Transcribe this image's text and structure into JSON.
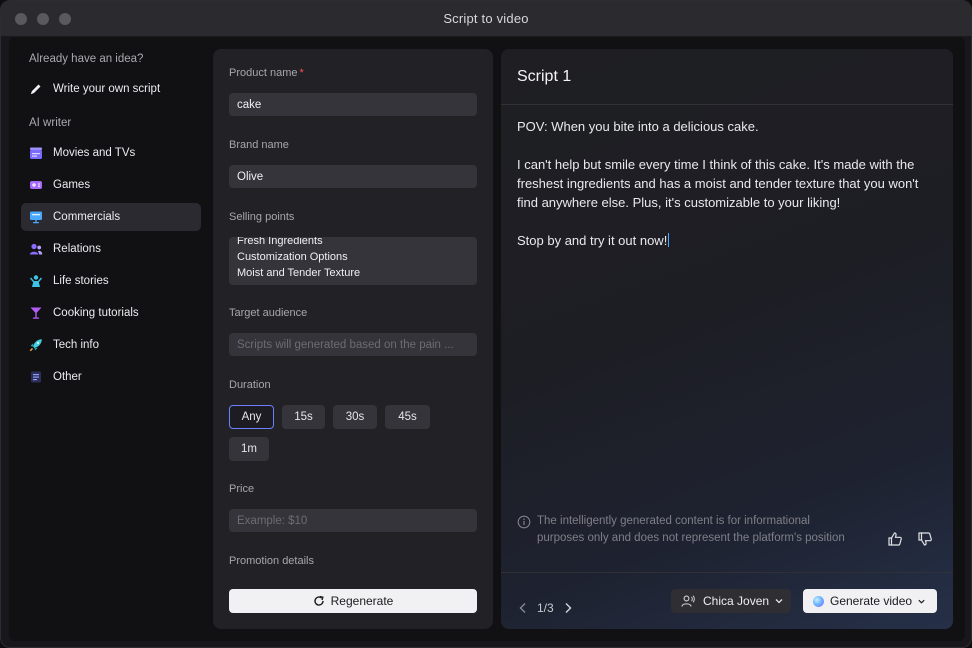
{
  "window": {
    "title": "Script to video"
  },
  "sidebar": {
    "heading_idea": "Already have an idea?",
    "write_own": "Write your own script",
    "heading_ai": "AI writer",
    "items": [
      {
        "label": "Movies and TVs",
        "icon": "clapperboard-icon",
        "color": "#7b6cff"
      },
      {
        "label": "Games",
        "icon": "gamepad-icon",
        "color": "#a86bff"
      },
      {
        "label": "Commercials",
        "icon": "monitor-icon",
        "color": "#4aa8ff",
        "active": true
      },
      {
        "label": "Relations",
        "icon": "people-icon",
        "color": "#8a6cff"
      },
      {
        "label": "Life stories",
        "icon": "person-wave-icon",
        "color": "#3fc4e6"
      },
      {
        "label": "Cooking tutorials",
        "icon": "cocktail-icon",
        "color": "#b35cf6"
      },
      {
        "label": "Tech info",
        "icon": "rocket-icon",
        "color": "#3fd0e0"
      },
      {
        "label": "Other",
        "icon": "list-icon",
        "color": "#6f7dff"
      }
    ]
  },
  "form": {
    "product_name": {
      "label": "Product name",
      "required_mark": "*",
      "value": "cake"
    },
    "brand_name": {
      "label": "Brand name",
      "value": "Olive"
    },
    "selling_points": {
      "label": "Selling points",
      "lines": [
        "Fresh Ingredients",
        "Customization Options",
        "Moist and Tender Texture"
      ]
    },
    "target_audience": {
      "label": "Target audience",
      "placeholder": "Scripts will generated based on the pain ..."
    },
    "duration": {
      "label": "Duration",
      "options": [
        "Any",
        "15s",
        "30s",
        "45s",
        "1m"
      ],
      "selected": "Any"
    },
    "price": {
      "label": "Price",
      "placeholder": "Example: $10"
    },
    "promotion": {
      "label": "Promotion details"
    },
    "regenerate_label": "Regenerate"
  },
  "script": {
    "title": "Script 1",
    "paragraphs": [
      "POV: When you bite into a delicious cake.",
      "I can't help but smile every time I think of this cake. It's made with the freshest ingredients and has a moist and tender texture that you won't find anywhere else. Plus, it's customizable to your liking!",
      "Stop by and try it out now!"
    ],
    "disclaimer": "The intelligently generated content is for informational purposes only and does not represent the platform's position",
    "pager": "1/3",
    "voice_label": "Chica Joven",
    "generate_label": "Generate video"
  },
  "colors": {
    "accent": "#6f7dff",
    "required": "#ff4d5a",
    "caret": "#4ea8ff"
  }
}
